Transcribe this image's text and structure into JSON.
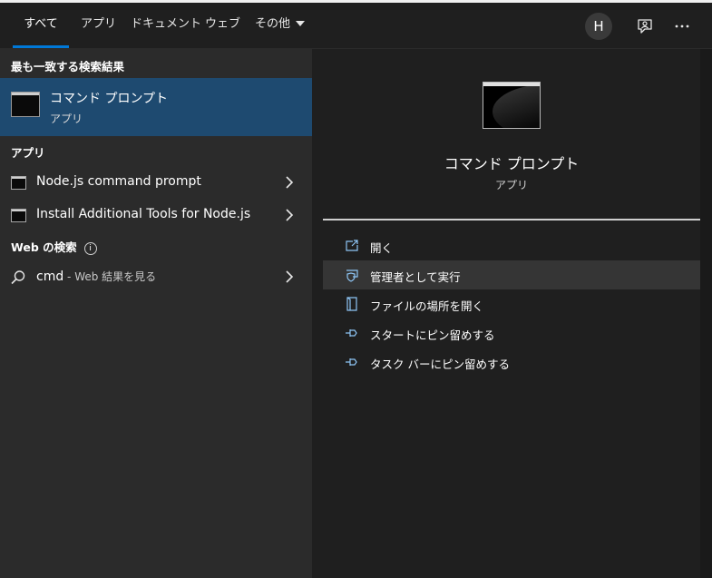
{
  "header": {
    "tabs": [
      {
        "label": "すべて",
        "active": true
      },
      {
        "label": "アプリ"
      },
      {
        "label": "ドキュメント"
      },
      {
        "label": "ウェブ"
      },
      {
        "label": "その他"
      }
    ],
    "avatar_initial": "H",
    "feedback_icon": "feedback-person-icon",
    "more_icon": "more-ellipsis-icon"
  },
  "left": {
    "best_match_header": "最も一致する検索結果",
    "best_match": {
      "title": "コマンド プロンプト",
      "subtitle": "アプリ",
      "icon": "command-prompt-icon"
    },
    "apps_header": "アプリ",
    "apps": [
      {
        "label": "Node.js command prompt",
        "icon": "console-icon"
      },
      {
        "label": "Install Additional Tools for Node.js",
        "icon": "console-icon"
      }
    ],
    "web_header": "Web の検索",
    "web_info_glyph": "i",
    "web_result": {
      "query": "cmd",
      "suffix": " - Web 結果を見る",
      "icon": "search-icon"
    }
  },
  "right": {
    "app_name": "コマンド プロンプト",
    "app_type": "アプリ",
    "actions": [
      {
        "label": "開く",
        "icon": "open-icon"
      },
      {
        "label": "管理者として実行",
        "icon": "run-as-admin-icon",
        "highlighted": true
      },
      {
        "label": "ファイルの場所を開く",
        "icon": "file-location-icon"
      },
      {
        "label": "スタートにピン留めする",
        "icon": "pin-icon"
      },
      {
        "label": "タスク バーにピン留めする",
        "icon": "pin-icon"
      }
    ]
  },
  "colors": {
    "accent": "#0078d7",
    "selected_bg": "#1e4a70",
    "left_panel_bg": "#2b2b2b",
    "window_bg": "#1f1f1f",
    "action_icon": "#8ec5f5"
  }
}
